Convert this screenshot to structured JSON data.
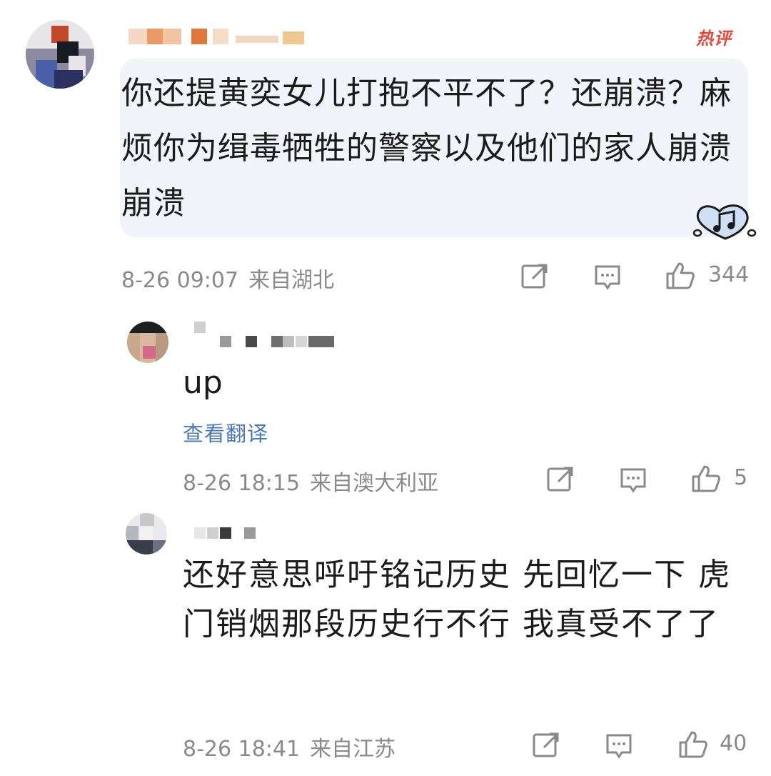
{
  "hot_badge": "热评",
  "comments": [
    {
      "text": "你还提黄奕女儿打抱不平不了？还崩溃？麻烦你为缉毒牺牲的警察以及他们的家人崩溃崩溃",
      "time": "8-26 09:07",
      "location": "来自湖北",
      "likes": "344"
    },
    {
      "text": "up",
      "translate_label": "查看翻译",
      "time": "8-26 18:15",
      "location": "来自澳大利亚",
      "likes": "5"
    },
    {
      "text": "还好意思呼吁铭记历史 先回忆一下 虎门销烟那段历史行不行 我真受不了了",
      "time": "8-26 18:41",
      "location": "来自江苏",
      "likes": "40"
    }
  ],
  "icons": {
    "share": "share-icon",
    "comment": "comment-icon",
    "like": "thumbs-up-icon"
  },
  "colors": {
    "hot_badge": "#e8473b",
    "bubble_bg": "#f3f4fa",
    "meta_text": "#8a8a8a",
    "link": "#4a78b8"
  }
}
